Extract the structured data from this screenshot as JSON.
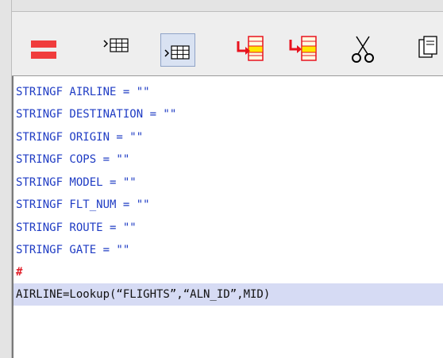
{
  "toolbar": {
    "buttons": [
      {
        "icon": "equals-icon",
        "pressed": false
      },
      {
        "icon": "insert-row-icon",
        "pressed": false
      },
      {
        "icon": "indent-table-icon",
        "pressed": true
      },
      {
        "icon": "move-right-table-icon",
        "pressed": false
      },
      {
        "icon": "move-left-table-icon",
        "pressed": false
      },
      {
        "icon": "cut-icon",
        "pressed": false
      },
      {
        "icon": "copy-icon",
        "pressed": false
      }
    ],
    "colors": {
      "red": "#f03c3c",
      "yellow": "#ffe800",
      "accent_red": "#e8121e"
    }
  },
  "editor": {
    "lines": [
      {
        "text": "STRINGF AIRLINE = \"\""
      },
      {
        "text": "STRINGF DESTINATION = \"\""
      },
      {
        "text": "STRINGF ORIGIN = \"\""
      },
      {
        "text": "STRINGF COPS = \"\""
      },
      {
        "text": "STRINGF MODEL = \"\""
      },
      {
        "text": "STRINGF FLT_NUM = \"\""
      },
      {
        "text": "STRINGF ROUTE = \"\""
      },
      {
        "text": "STRINGF GATE = \"\""
      },
      {
        "text": "#"
      },
      {
        "text": "AIRLINE=Lookup(“FLIGHTS”,“ALN_ID”,MID)"
      }
    ],
    "colors": {
      "code_text": "#1f3cc4",
      "comment_text": "#e0202a",
      "selection_bg": "#d6dbf4"
    }
  }
}
